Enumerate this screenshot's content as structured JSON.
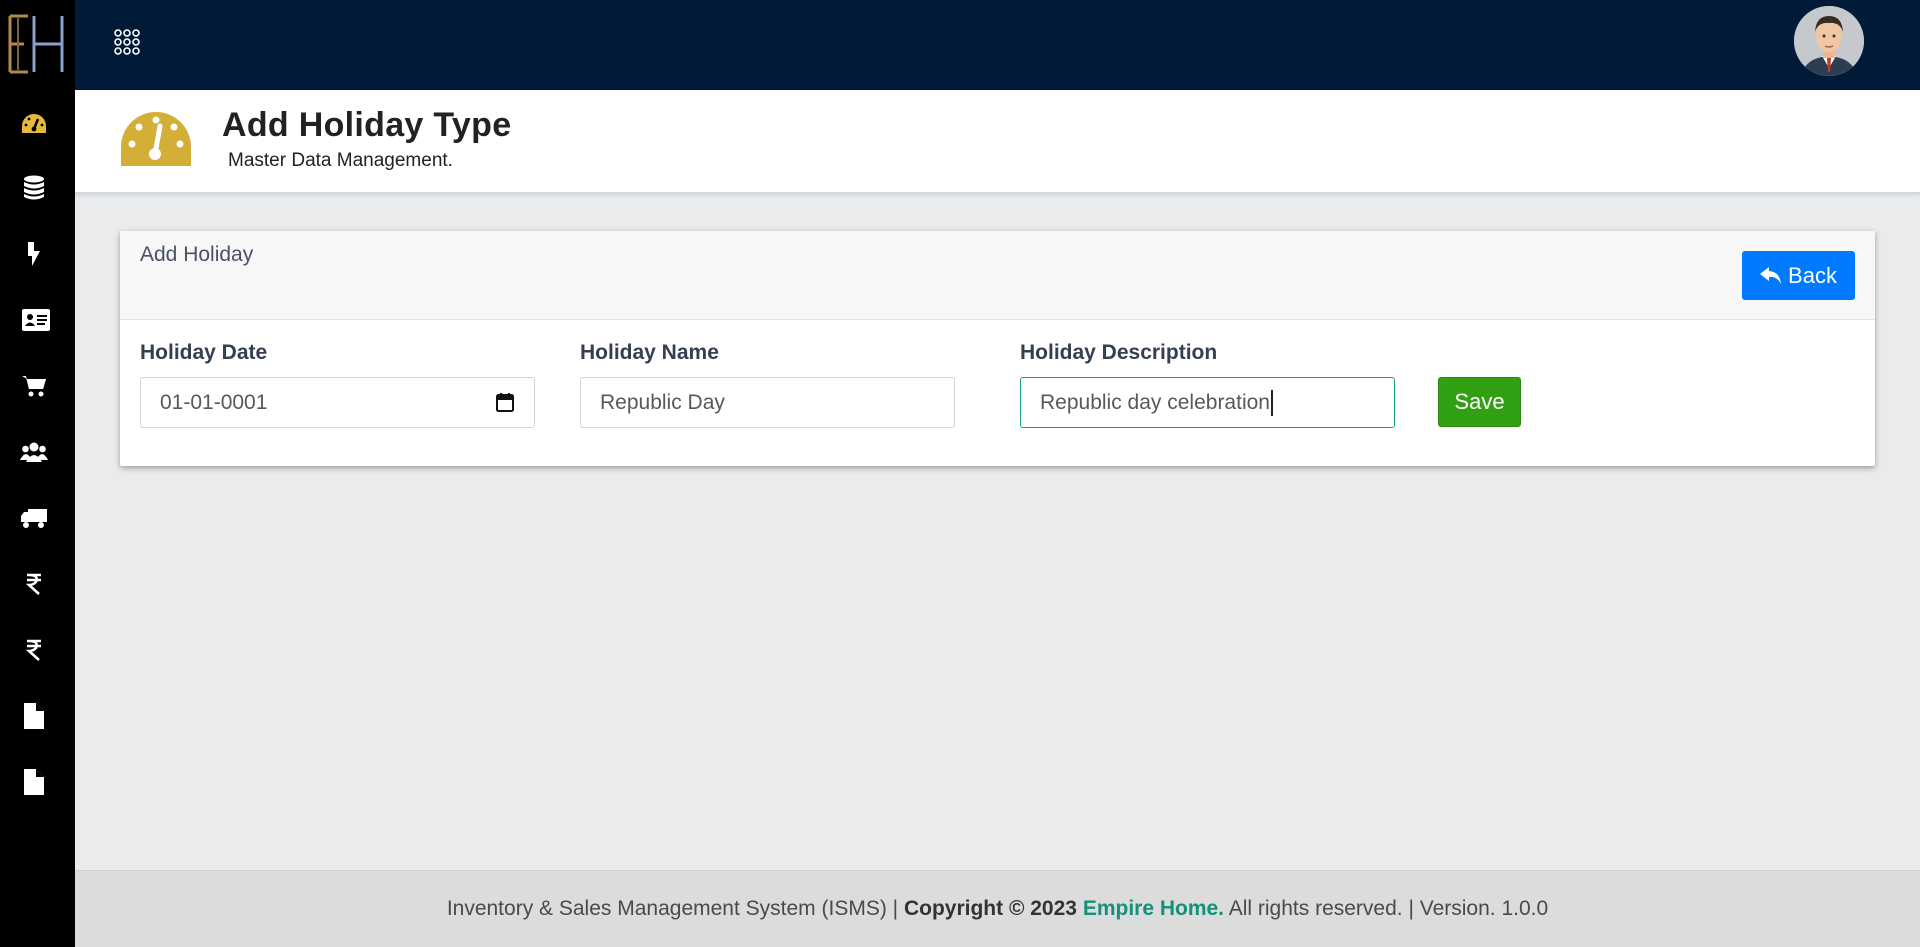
{
  "brand": {
    "logo_icon": "eh-monogram-logo"
  },
  "sidebar": {
    "items": [
      {
        "icon": "dashboard-icon"
      },
      {
        "icon": "database-icon"
      },
      {
        "icon": "bolt-icon"
      },
      {
        "icon": "id-card-icon"
      },
      {
        "icon": "cart-icon"
      },
      {
        "icon": "users-icon"
      },
      {
        "icon": "truck-icon"
      },
      {
        "icon": "rupee-icon"
      },
      {
        "icon": "rupee-icon"
      },
      {
        "icon": "file-icon"
      },
      {
        "icon": "file-icon"
      }
    ]
  },
  "topbar": {
    "apps_icon": "apps-grid-icon",
    "user_icon": "user-avatar"
  },
  "page": {
    "title": "Add Holiday Type",
    "subtitle": "Master Data Management."
  },
  "card": {
    "title": "Add Holiday",
    "back_label": "Back"
  },
  "form": {
    "holiday_date": {
      "label": "Holiday Date",
      "value": "01-01-0001"
    },
    "holiday_name": {
      "label": "Holiday Name",
      "value": "Republic Day"
    },
    "holiday_description": {
      "label": "Holiday Description",
      "value": "Republic day celebration"
    },
    "save_label": "Save"
  },
  "footer": {
    "system": "Inventory & Sales Management System (ISMS) |",
    "copyright": "Copyright © 2023",
    "company": "Empire Home.",
    "rights": "All rights reserved. | Version. 1.0.0"
  },
  "colors": {
    "topbar": "#001a38",
    "sidebar": "#000000",
    "accent_gold": "#d4af37",
    "primary_blue": "#007bff",
    "save_green": "#31a013",
    "brand_teal": "#149178"
  }
}
